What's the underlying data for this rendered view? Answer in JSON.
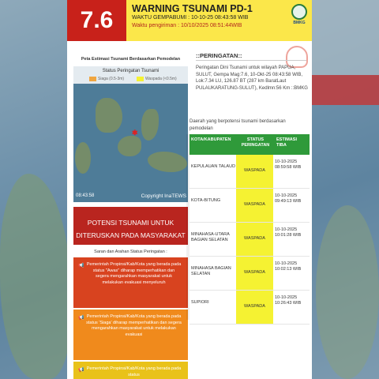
{
  "header": {
    "magnitude": "7.6",
    "title": "WARNING TSUNAMI PD-1",
    "waktu_gempabumi": "WAKTU GEMPABUMI : 10-10-25 08:43:58 WIB",
    "waktu_pengiriman": "Waktu pengiriman : 10/10/2025 08:51:44WIB",
    "logo_text": "BMKG"
  },
  "map": {
    "title": "Peta Estimasi Tsunami Berdasarkan Pemodelan",
    "status_title": "Status Peringatan Tsunami",
    "legend": [
      {
        "label": "Siaga (0.5-3m)",
        "color": "#f0a640"
      },
      {
        "label": "Waspada (<0.5m)",
        "color": "#f5f232"
      }
    ],
    "time": "08:43:58",
    "copyright": "Copyright InaTEWS"
  },
  "potensi": "POTENSI TSUNAMI UNTUK DITERUSKAN PADA MASYARAKAT",
  "saran_title": "Saran dan Arahan Status Peringatan :",
  "advice": [
    {
      "text": "Pemerintah Propinsi/Kab/Kota yang berada pada status \"Awas\" diharap memperhatikan dan segera mengarahkan masyarakat untuk melakukan evakuasi menyeluruh",
      "color": "#d8431f"
    },
    {
      "text": "Pemerintah Propinsi/Kab/Kota yang berada pada status 'Siaga' diharap memperhatikan dan segera mengarahkan masyarakat untuk melakukan evakuasi",
      "color": "#f08a1c"
    },
    {
      "text": "Pemerintah Propinsi/Kab/Kota yang berada pada status",
      "color": "#e9c21a"
    }
  ],
  "peringatan": {
    "title": "::PERINGATAN::",
    "text": "Peringatan Dini Tsunami untuk wilayah PAPUA, SULUT, Gempa Mag:7.6, 10-Okt-25 08:43:58 WIB, Lok:7.34 LU, 126.87 BT (287 km BaratLaut PULAUKARATUNG-SULUT), Kedlmn:56 Km ::BMKG"
  },
  "daerah_text": "Daerah yang berpotensi tsunami berdasarkan pemodelan",
  "table": {
    "headers": [
      "KOTA/KABUPATEN",
      "STATUS PERINGATAN",
      "ESTIMASI TIBA"
    ],
    "rows": [
      {
        "kota": "KEPULAUAN TALAUD",
        "status": "WASPADA",
        "tiba": "10-10-2025 08:59:58 WIB"
      },
      {
        "kota": "KOTA-BITUNG",
        "status": "WASPADA",
        "tiba": "10-10-2025 09:49:13 WIB"
      },
      {
        "kota": "MINAHASA-UTARA BAGIAN SELATAN",
        "status": "WASPADA",
        "tiba": "10-10-2025 10:01:28 WIB"
      },
      {
        "kota": "MINAHASA BAGIAN SELATAN",
        "status": "WASPADA",
        "tiba": "10-10-2025 10:02:13 WIB"
      },
      {
        "kota": "SUPIORI",
        "status": "WASPADA",
        "tiba": "10-10-2025 10:26:43 WIB"
      }
    ]
  }
}
